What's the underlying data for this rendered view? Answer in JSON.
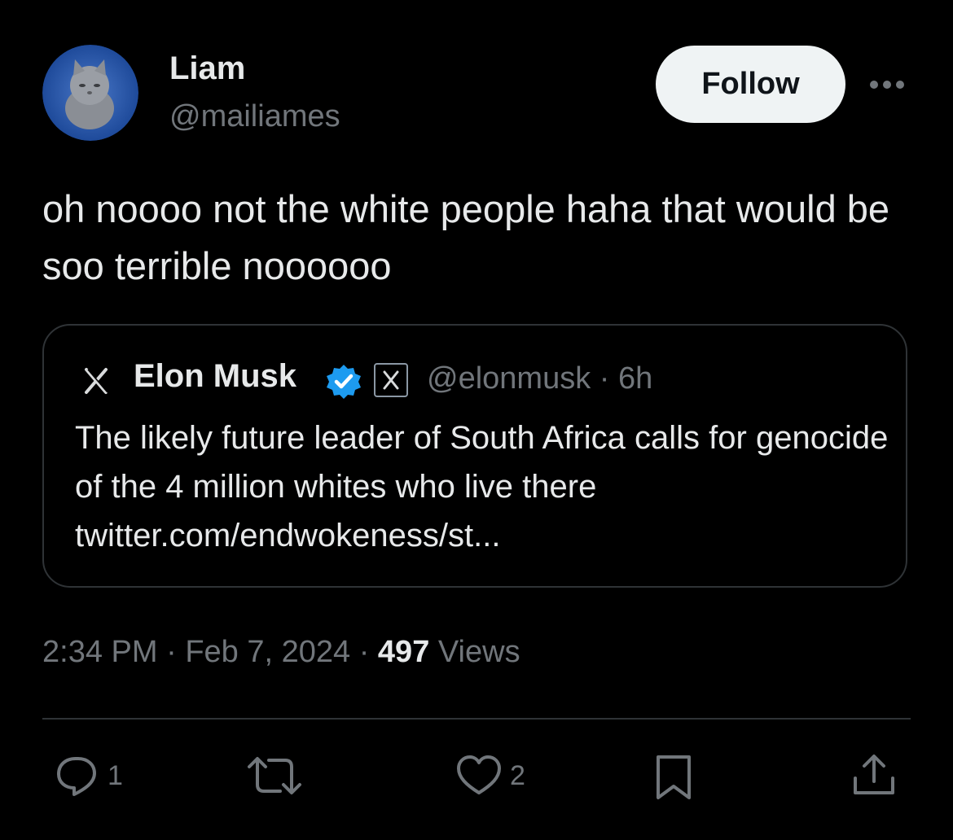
{
  "author": {
    "display_name": "Liam",
    "handle": "@mailiames",
    "avatar_icon": "cat-avatar"
  },
  "follow_label": "Follow",
  "more_icon": "more-horizontal-icon",
  "tweet": {
    "text": "oh noooo not the white people haha that would be soo terrible noooooo"
  },
  "quote": {
    "avatar_icon": "x-logo-icon",
    "name": "Elon Musk",
    "verified_icon": "verified-badge-icon",
    "affiliation_icon": "x-affiliation-badge-icon",
    "handle_time": "@elonmusk · 6h",
    "text": "The likely future leader of South Africa calls for genocide of the 4 million whites who live there twitter.com/endwokeness/st..."
  },
  "meta": {
    "time": "2:34 PM",
    "sep1": "·",
    "date": "Feb 7, 2024",
    "sep2": "·",
    "views_count": "497",
    "views_label": "Views"
  },
  "actions": {
    "reply": {
      "icon": "reply-icon",
      "count": "1"
    },
    "retweet": {
      "icon": "retweet-icon"
    },
    "like": {
      "icon": "heart-icon",
      "count": "2"
    },
    "bookmark": {
      "icon": "bookmark-icon"
    },
    "share": {
      "icon": "share-icon"
    }
  },
  "colors": {
    "background": "#000000",
    "text_primary": "#e7e9ea",
    "text_secondary": "#71767b",
    "border": "#2f3336",
    "verified_blue": "#1d9bf0",
    "follow_bg": "#eff3f4"
  }
}
